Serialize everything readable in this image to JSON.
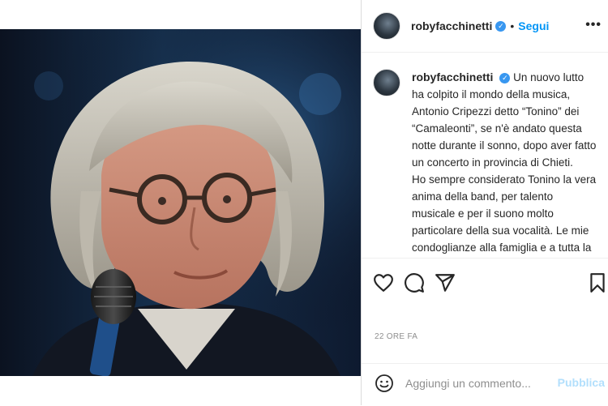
{
  "post": {
    "username": "robyfacchinetti",
    "verified_icon": "verified-badge-icon",
    "follow_separator": "•",
    "follow_label": "Segui",
    "more_label": "•••"
  },
  "caption": {
    "username": "robyfacchinetti",
    "paragraphs": [
      "Un nuovo lutto ha colpito il mondo della musica, Antonio Cripezzi detto “Tonino” dei “Camaleonti”, se n'è andato questa notte durante il sonno, dopo aver fatto un concerto in provincia di Chieti.",
      "Ho sempre considerato Tonino la vera anima della band, per talento musicale e per il suono molto particolare della sua vocalità. Le mie condoglianze alla famiglia e a tutta la"
    ]
  },
  "actions": {
    "icons": [
      "heart-icon",
      "comment-icon",
      "share-icon",
      "bookmark-icon"
    ]
  },
  "timestamp": "22 ORE FA",
  "comment": {
    "placeholder": "Aggiungi un commento...",
    "publish_label": "Pubblica",
    "emoji_icon": "emoji-icon"
  },
  "colors": {
    "accent": "#0095f6",
    "verified": "#3897f0",
    "publish_disabled": "#b2dffc",
    "muted": "#8e8e8e"
  }
}
